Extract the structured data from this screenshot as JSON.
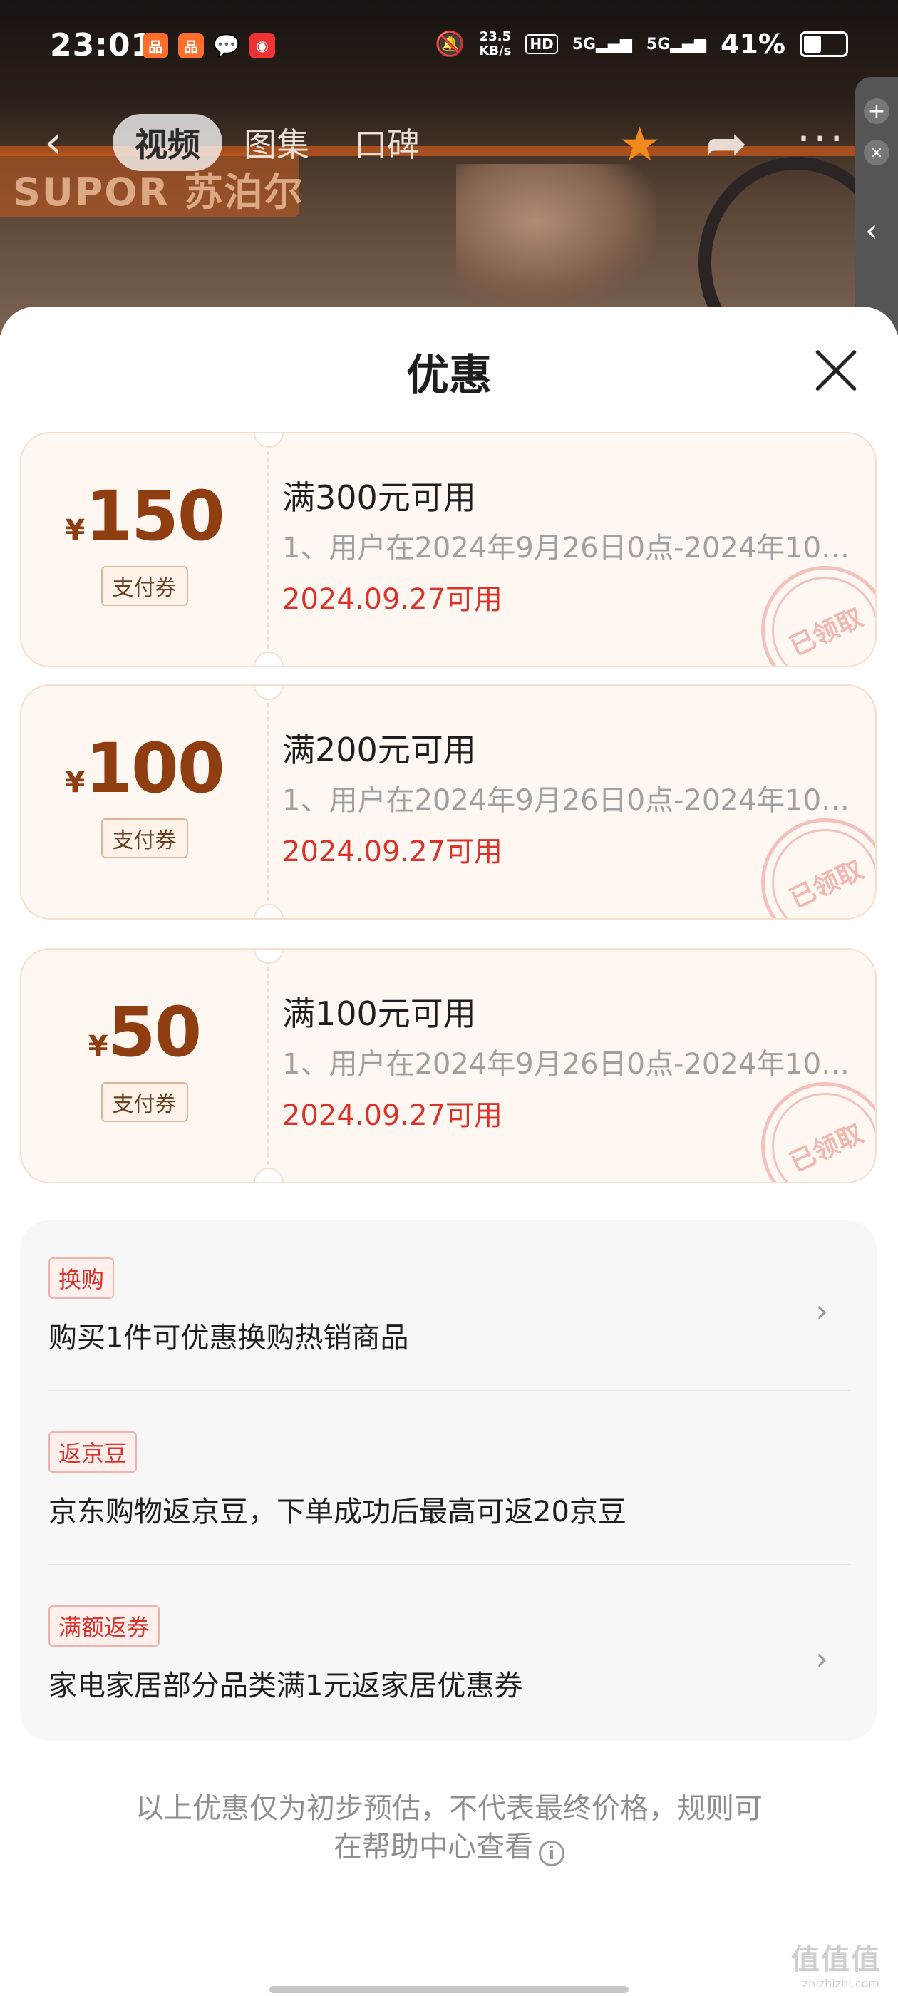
{
  "status_bar": {
    "time": "23:01",
    "app_icons": [
      "app-icon-1",
      "app-icon-2",
      "wechat-icon",
      "weibo-icon"
    ],
    "net_speed_value": "23.5",
    "net_speed_unit": "KB/s",
    "hd": "HD",
    "sim1": "5G",
    "sim2": "5G",
    "battery": "41%"
  },
  "nav": {
    "tabs": [
      {
        "label": "视频",
        "active": true
      },
      {
        "label": "图集",
        "active": false
      },
      {
        "label": "口碑",
        "active": false
      }
    ]
  },
  "hero": {
    "brand": "SUPOR 苏泊尔"
  },
  "sheet": {
    "title": "优惠",
    "coupons": [
      {
        "yen": "¥",
        "amount": "150",
        "type": "支付券",
        "condition": "满300元可用",
        "desc": "1、用户在2024年9月26日0点-2024年10…",
        "date": "2024.09.27可用",
        "stamp": "已领取"
      },
      {
        "yen": "¥",
        "amount": "100",
        "type": "支付券",
        "condition": "满200元可用",
        "desc": "1、用户在2024年9月26日0点-2024年10…",
        "date": "2024.09.27可用",
        "stamp": "已领取"
      },
      {
        "yen": "¥",
        "amount": "50",
        "type": "支付券",
        "condition": "满100元可用",
        "desc": "1、用户在2024年9月26日0点-2024年10…",
        "date": "2024.09.27可用",
        "stamp": "已领取"
      }
    ],
    "promos": [
      {
        "badge": "换购",
        "text": "购买1件可优惠换购热销商品",
        "has_arrow": true
      },
      {
        "badge": "返京豆",
        "text": "京东购物返京豆，下单成功后最高可返20京豆",
        "has_arrow": false
      },
      {
        "badge": "满额返券",
        "text": "家电家居部分品类满1元返家居优惠券",
        "has_arrow": true
      }
    ],
    "footer_line1": "以上优惠仅为初步预估，不代表最终价格，规则可",
    "footer_line2": "在帮助中心查看"
  },
  "watermark": "值值值",
  "watermark_sub": "zhizhizhi.com",
  "colors": {
    "price": "#8e3e10",
    "accent_red": "#d9342b",
    "coupon_bg": "#fff8f2"
  }
}
